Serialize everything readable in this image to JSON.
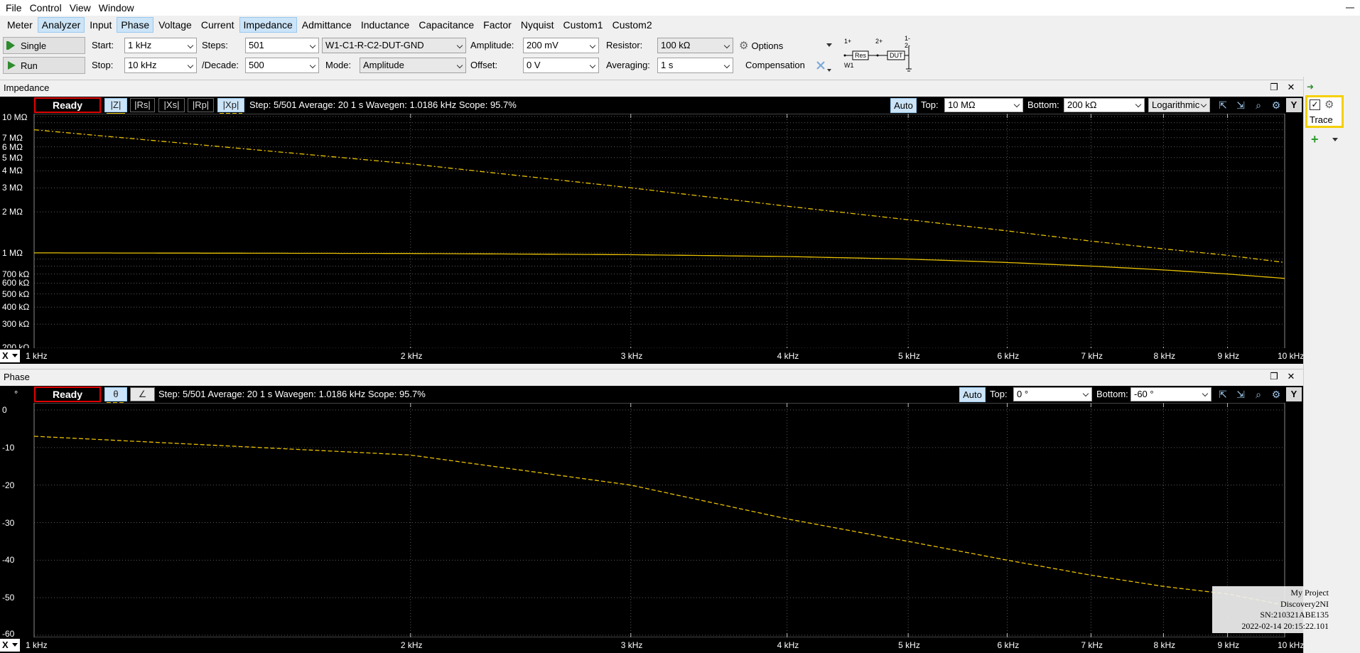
{
  "menu": [
    "File",
    "Control",
    "View",
    "Window"
  ],
  "tabs": [
    {
      "label": "Meter",
      "selected": false
    },
    {
      "label": "Analyzer",
      "selected": true
    },
    {
      "label": "Input",
      "selected": false
    },
    {
      "label": "Phase",
      "selected": true
    },
    {
      "label": "Voltage",
      "selected": false
    },
    {
      "label": "Current",
      "selected": false
    },
    {
      "label": "Impedance",
      "selected": true
    },
    {
      "label": "Admittance",
      "selected": false
    },
    {
      "label": "Inductance",
      "selected": false
    },
    {
      "label": "Capacitance",
      "selected": false
    },
    {
      "label": "Factor",
      "selected": false
    },
    {
      "label": "Nyquist",
      "selected": false
    },
    {
      "label": "Custom1",
      "selected": false
    },
    {
      "label": "Custom2",
      "selected": false
    }
  ],
  "toolbar": {
    "single": "Single",
    "run": "Run",
    "start_label": "Start:",
    "start": "1 kHz",
    "stop_label": "Stop:",
    "stop": "10 kHz",
    "steps_label": "Steps:",
    "steps": "501",
    "decade_label": "/Decade:",
    "decade": "500",
    "config": "W1-C1-R-C2-DUT-GND",
    "mode_label": "Mode:",
    "mode": "Amplitude",
    "amplitude_label": "Amplitude:",
    "amplitude": "200 mV",
    "offset_label": "Offset:",
    "offset": "0 V",
    "resistor_label": "Resistor:",
    "resistor": "100 kΩ",
    "averaging_label": "Averaging:",
    "averaging": "1 s",
    "options": "Options",
    "compensation": "Compensation",
    "diagram": {
      "n1p": "1+",
      "n2p": "2+",
      "n1m": "1-",
      "n2m": "2-",
      "res": "Res",
      "dut": "DUT",
      "w1": "W1"
    }
  },
  "impedance": {
    "title": "Impedance",
    "ready": "Ready",
    "traces": [
      "|Z|",
      "|Rs|",
      "|Xs|",
      "|Rp|",
      "|Xp|"
    ],
    "status": "Step: 5/501 Average: 20 1 s Wavegen: 1.0186 kHz  Scope: 95.7%",
    "auto": "Auto",
    "top_label": "Top:",
    "top": "10 MΩ",
    "bottom_label": "Bottom:",
    "bottom": "200 kΩ",
    "scale": "Logarithmic",
    "y_button": "Y",
    "y_ticks": [
      "10 MΩ",
      "7 MΩ",
      "6 MΩ",
      "5 MΩ",
      "4 MΩ",
      "3 MΩ",
      "2 MΩ",
      "1 MΩ",
      "700 kΩ",
      "600 kΩ",
      "500 kΩ",
      "400 kΩ",
      "300 kΩ",
      "200 kΩ"
    ],
    "x_button": "X",
    "x_ticks": [
      "1 kHz",
      "2 kHz",
      "3 kHz",
      "4 kHz",
      "5 kHz",
      "6 kHz",
      "7 kHz",
      "8 kHz",
      "9 kHz",
      "10 kHz"
    ]
  },
  "phase": {
    "title": "Phase",
    "unit": "°",
    "ready": "Ready",
    "traces": [
      "θ",
      "∠"
    ],
    "status": "Step: 5/501 Average: 20 1 s Wavegen: 1.0186 kHz  Scope: 95.7%",
    "auto": "Auto",
    "top_label": "Top:",
    "top": "0 °",
    "bottom_label": "Bottom:",
    "bottom": "-60 °",
    "y_button": "Y",
    "y_ticks": [
      "0",
      "-10",
      "-20",
      "-30",
      "-40",
      "-50",
      "-60"
    ],
    "x_ticks": [
      "1 kHz",
      "2 kHz",
      "3 kHz",
      "4 kHz",
      "5 kHz",
      "6 kHz",
      "7 kHz",
      "8 kHz",
      "9 kHz",
      "10 kHz"
    ]
  },
  "right_panel": {
    "trace": "Trace"
  },
  "watermark": {
    "project": "My Project",
    "device": "Discovery2NI",
    "serial": "SN:210321ABE135",
    "timestamp": "2022-02-14 20:15:22.101"
  },
  "colors": {
    "trace": "#e8c000",
    "ready_border": "#e00000",
    "plot_bg": "#000000",
    "selected_tab": "#cce4f7"
  },
  "chart_data": [
    {
      "type": "line",
      "title": "Impedance",
      "xscale": "log",
      "yscale": "log",
      "xlim": [
        1000,
        10000
      ],
      "ylim": [
        200000,
        10000000
      ],
      "grid": true,
      "series": [
        {
          "name": "|Z|",
          "style": "solid",
          "x": [
            1000,
            2000,
            3000,
            4000,
            5000,
            6000,
            7000,
            8000,
            9000,
            10000
          ],
          "values": [
            1000000,
            990000,
            970000,
            940000,
            900000,
            850000,
            800000,
            750000,
            700000,
            650000
          ]
        },
        {
          "name": "|Xp|",
          "style": "dashdot",
          "x": [
            1000,
            2000,
            3000,
            4000,
            5000,
            6000,
            7000,
            8000,
            9000,
            10000
          ],
          "values": [
            8000000,
            4500000,
            3000000,
            2200000,
            1750000,
            1450000,
            1220000,
            1070000,
            960000,
            850000
          ]
        }
      ]
    },
    {
      "type": "line",
      "title": "Phase",
      "xscale": "log",
      "xlim": [
        1000,
        10000
      ],
      "ylim": [
        -60,
        0
      ],
      "grid": true,
      "series": [
        {
          "name": "θ",
          "style": "dashed",
          "x": [
            1000,
            2000,
            3000,
            4000,
            5000,
            6000,
            7000,
            8000,
            9000,
            10000
          ],
          "values": [
            -7,
            -12,
            -20,
            -29,
            -35,
            -40,
            -44,
            -47,
            -49,
            -52
          ]
        }
      ]
    }
  ]
}
